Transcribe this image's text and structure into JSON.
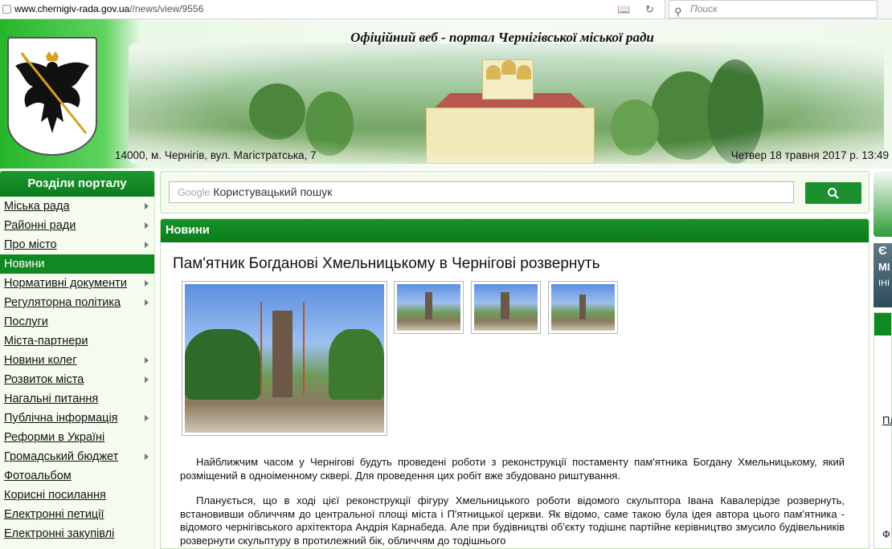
{
  "browser": {
    "url_host": "www.chernigiv-rada.gov.ua",
    "url_path": "//news/view/9556",
    "search_placeholder": "Поиск"
  },
  "header": {
    "title": "Офіційний веб - портал Чернігівської міської ради",
    "address": "14000, м. Чернігів, вул. Магістратська, 7",
    "date": "Четвер 18 травня 2017 р. 13:49"
  },
  "sidebar": {
    "heading": "Розділи порталу",
    "items": [
      {
        "label": "Міська рада",
        "arrow": true,
        "active": false
      },
      {
        "label": "Районні ради",
        "arrow": true,
        "active": false
      },
      {
        "label": "Про місто",
        "arrow": true,
        "active": false
      },
      {
        "label": "Новини",
        "arrow": false,
        "active": true
      },
      {
        "label": "Нормативні документи",
        "arrow": true,
        "active": false
      },
      {
        "label": "Регуляторна політика",
        "arrow": true,
        "active": false
      },
      {
        "label": "Послуги",
        "arrow": false,
        "active": false
      },
      {
        "label": "Міста-партнери",
        "arrow": false,
        "active": false
      },
      {
        "label": "Новини колег",
        "arrow": true,
        "active": false
      },
      {
        "label": "Розвиток міста",
        "arrow": true,
        "active": false
      },
      {
        "label": "Нагальні питання",
        "arrow": false,
        "active": false
      },
      {
        "label": "Публічна інформація",
        "arrow": true,
        "active": false
      },
      {
        "label": "Реформи в Україні",
        "arrow": false,
        "active": false
      },
      {
        "label": "Громадський бюджет",
        "arrow": true,
        "active": false
      },
      {
        "label": "Фотоальбом",
        "arrow": false,
        "active": false
      },
      {
        "label": "Корисні посилання",
        "arrow": false,
        "active": false
      },
      {
        "label": "Електронні петиції",
        "arrow": false,
        "active": false
      },
      {
        "label": "Електронні закупівлі",
        "arrow": false,
        "active": false
      }
    ]
  },
  "search": {
    "google_label": "Google",
    "placeholder": "Користувацький пошук"
  },
  "news": {
    "section_title": "Новини",
    "article_title": "Пам'ятник Богданові Хмельницькому в Чернігові розвернуть",
    "paragraph_1": "Найближчим часом у Чернігові будуть проведені роботи з реконструкції постаменту пам'ятника Богдану Хмельницькому, який розміщений в одноіменному сквері. Для проведення цих робіт вже збудовано риштування.",
    "paragraph_2": "Планується, що в ході цієї реконструкції фігуру Хмельницького роботи відомого скульптора Івана Кавалерідзе розвернуть, встановивши обличчям до центральної площі міста і П'ятницької церкви. Як відомо, саме такою була ідея автора цього пам'ятника - відомого чернігівського архітектора Андрія Карнабеда. Але при будівництві об'єкту тодішнє партійне керівництво змусило будівельників розвернути скульптуру в протилежний бік, обличчям до тодішнього"
  },
  "right": {
    "banner_letters": [
      "Є",
      "МІ",
      "ІНІ"
    ],
    "link_fragment": "ПЛ",
    "text_fragment": "Ф"
  }
}
